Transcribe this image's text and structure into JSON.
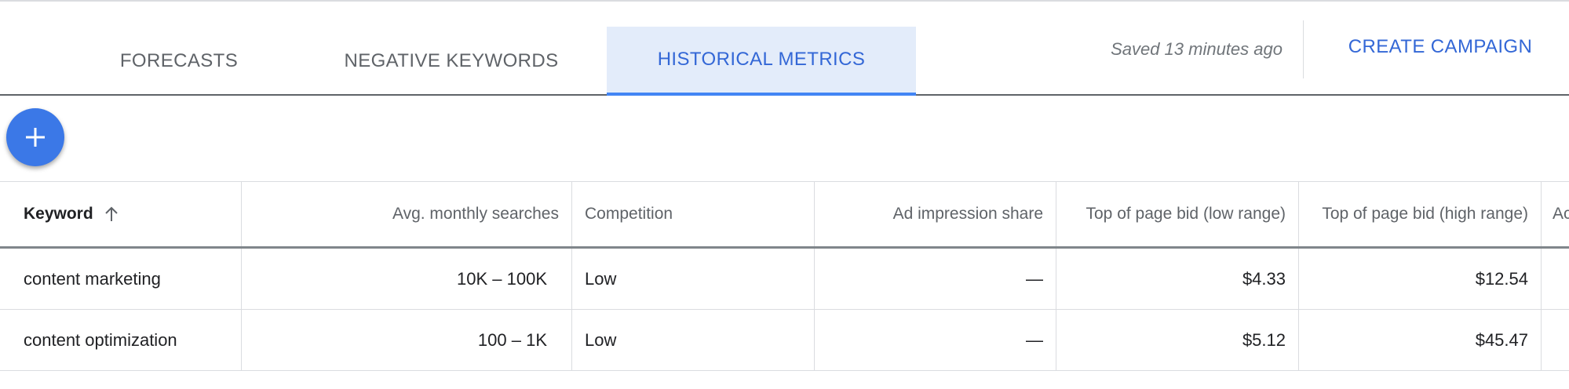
{
  "tabs": [
    {
      "label": "FORECASTS",
      "active": false
    },
    {
      "label": "NEGATIVE KEYWORDS",
      "active": false
    },
    {
      "label": "HISTORICAL METRICS",
      "active": true
    }
  ],
  "status": {
    "saved_text": "Saved 13 minutes ago"
  },
  "actions": {
    "create_campaign": "CREATE CAMPAIGN",
    "fab_icon": "plus-icon"
  },
  "table": {
    "headers": {
      "keyword": "Keyword",
      "avg_monthly_searches": "Avg. monthly searches",
      "competition": "Competition",
      "ad_impression_share": "Ad impression share",
      "top_bid_low": "Top of page bid (low range)",
      "top_bid_high": "Top of page bid (high range)",
      "next_col_partial": "Ac"
    },
    "sort": {
      "column": "Keyword",
      "direction": "ascending",
      "icon": "arrow-up-icon"
    },
    "rows": [
      {
        "keyword": "content marketing",
        "avg_monthly_searches": "10K – 100K",
        "competition": "Low",
        "ad_impression_share": "—",
        "top_bid_low": "$4.33",
        "top_bid_high": "$12.54"
      },
      {
        "keyword": "content optimization",
        "avg_monthly_searches": "100 – 1K",
        "competition": "Low",
        "ad_impression_share": "—",
        "top_bid_low": "$5.12",
        "top_bid_high": "$45.47"
      }
    ]
  },
  "colors": {
    "accent": "#3367d6",
    "active_tab_bg": "#e3ecfa",
    "fab": "#3b78e7"
  }
}
